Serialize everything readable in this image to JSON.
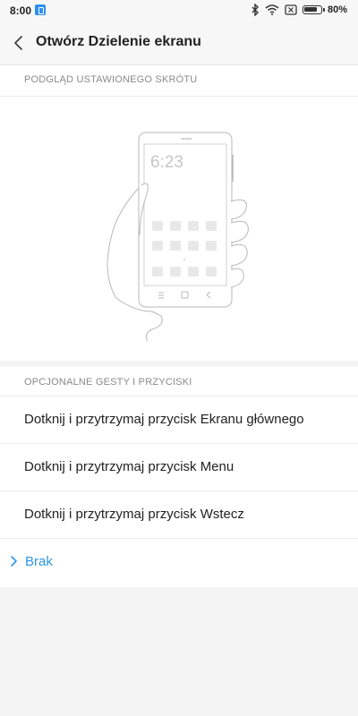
{
  "status_bar": {
    "time": "8:00",
    "battery_percent": "80%"
  },
  "header": {
    "title": "Otwórz Dzielenie ekranu"
  },
  "preview": {
    "section_title": "PODGLĄD USTAWIONEGO SKRÓTU",
    "phone_time": "6:23"
  },
  "options": {
    "section_title": "OPCJONALNE GESTY I PRZYCISKI",
    "items": [
      {
        "label": "Dotknij i przytrzymaj przycisk Ekranu głównego"
      },
      {
        "label": "Dotknij i przytrzymaj przycisk Menu"
      },
      {
        "label": "Dotknij i przytrzymaj przycisk Wstecz"
      }
    ],
    "selected": {
      "label": "Brak"
    }
  },
  "colors": {
    "accent": "#2d97e8",
    "background": "#f4f4f4",
    "text": "#222222",
    "muted": "#8a8a8a"
  },
  "icons": {
    "back": "chevron-left-icon",
    "selected_marker": "chevron-right-icon",
    "bluetooth": "bluetooth-icon",
    "wifi": "wifi-icon",
    "sim": "sim-icon",
    "battery": "battery-icon"
  }
}
